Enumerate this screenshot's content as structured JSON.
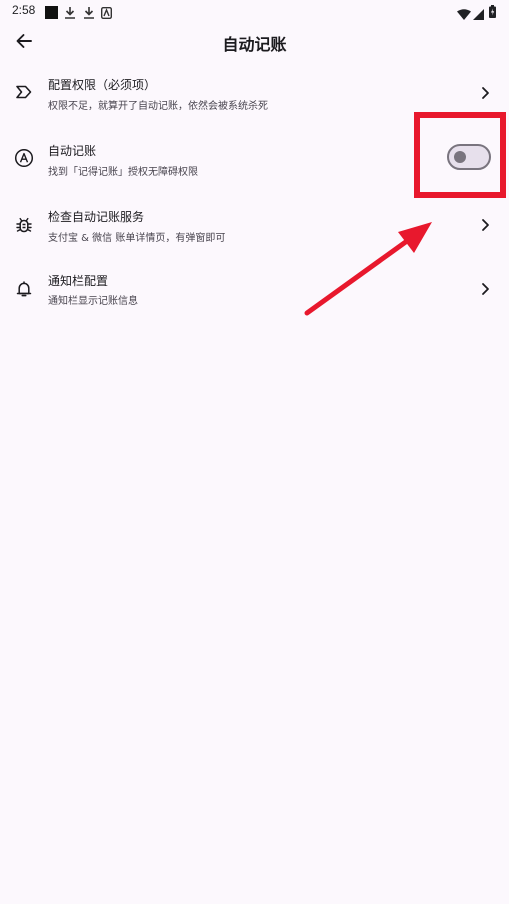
{
  "status_bar": {
    "time": "2:58",
    "left_icons": [
      "notification-square-icon",
      "download-icon",
      "download-icon",
      "app-notification-icon"
    ],
    "right_icons": [
      "wifi-icon",
      "signal-icon",
      "battery-icon"
    ]
  },
  "header": {
    "title": "自动记账",
    "back_icon": "back-arrow-icon"
  },
  "settings": [
    {
      "icon": "label-outline-icon",
      "title": "配置权限（必须项）",
      "subtitle": "权限不足，就算开了自动记账，依然会被系统杀死",
      "control": "chevron"
    },
    {
      "icon": "circle-a-icon",
      "title": "自动记账",
      "subtitle": "找到「记得记账」授权无障碍权限",
      "control": "switch",
      "switch_on": false
    },
    {
      "icon": "bug-icon",
      "title": "检查自动记账服务",
      "subtitle": "支付宝 & 微信 账单详情页，有弹窗即可",
      "control": "chevron"
    },
    {
      "icon": "bell-icon",
      "title": "通知栏配置",
      "subtitle": "通知栏显示记账信息",
      "control": "chevron"
    }
  ],
  "colors": {
    "background": "#fcf8fd",
    "annotation_red": "#e8182d",
    "switch_outline": "#79747e"
  }
}
